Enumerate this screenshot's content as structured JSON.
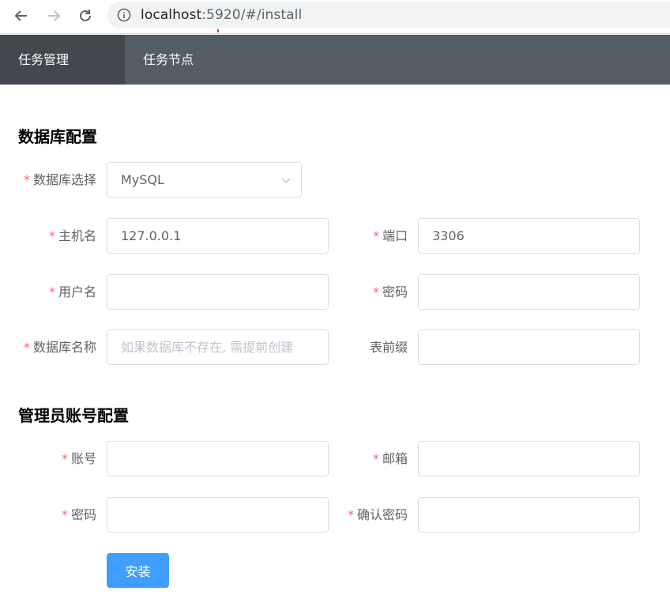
{
  "browser": {
    "url_host": "localhost",
    "url_rest": ":5920/#/install"
  },
  "header": {
    "tabs": [
      {
        "label": "任务管理",
        "active": true
      },
      {
        "label": "任务节点",
        "active": false
      }
    ]
  },
  "db_section": {
    "title": "数据库配置",
    "db_type": {
      "label": "数据库选择",
      "value": "MySQL",
      "required": true
    },
    "host": {
      "label": "主机名",
      "value": "127.0.0.1",
      "required": true
    },
    "port": {
      "label": "端口",
      "value": "3306",
      "required": true
    },
    "username": {
      "label": "用户名",
      "value": "",
      "required": true
    },
    "password": {
      "label": "密码",
      "value": "",
      "required": true
    },
    "db_name": {
      "label": "数据库名称",
      "value": "",
      "placeholder": "如果数据库不存在, 需提前创建",
      "required": true
    },
    "table_prefix": {
      "label": "表前缀",
      "value": "",
      "required": false
    }
  },
  "admin_section": {
    "title": "管理员账号配置",
    "account": {
      "label": "账号",
      "value": "",
      "required": true
    },
    "email": {
      "label": "邮箱",
      "value": "",
      "required": true
    },
    "password": {
      "label": "密码",
      "value": "",
      "required": true
    },
    "confirm_password": {
      "label": "确认密码",
      "value": "",
      "required": true
    }
  },
  "install_button": {
    "label": "安装"
  },
  "colors": {
    "header_bg": "#545c64",
    "header_active_bg": "#43484e",
    "primary": "#409eff",
    "required_star": "#f56c6c"
  }
}
